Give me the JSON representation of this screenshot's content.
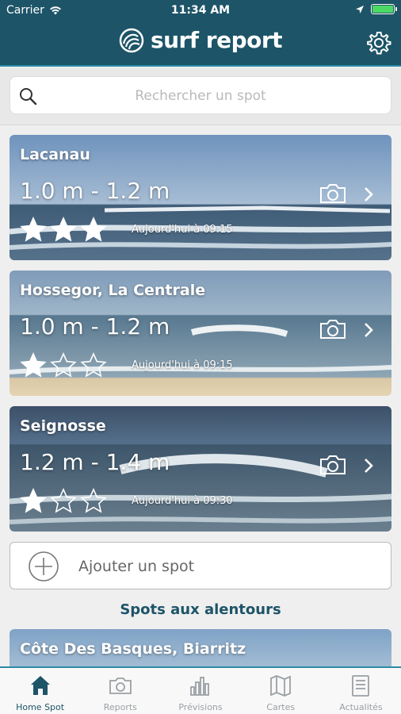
{
  "status_bar": {
    "carrier": "Carrier",
    "time": "11:34 AM"
  },
  "header": {
    "title": "surf report"
  },
  "search": {
    "placeholder": "Rechercher un spot"
  },
  "spots": [
    {
      "name": "Lacanau",
      "height": "1.0 m - 1.2 m",
      "rating": 3,
      "max_rating": 3,
      "time": "Aujourd'hui à 09:15"
    },
    {
      "name": "Hossegor, La Centrale",
      "height": "1.0 m - 1.2 m",
      "rating": 1,
      "max_rating": 3,
      "time": "Aujourd'hui à 09:15"
    },
    {
      "name": "Seignosse",
      "height": "1.2 m - 1.4 m",
      "rating": 1,
      "max_rating": 3,
      "time": "Aujourd'hui à 09:30"
    }
  ],
  "add_spot": {
    "label": "Ajouter un spot"
  },
  "nearby": {
    "title": "Spots aux alentours",
    "items": [
      {
        "name": "Côte Des Basques, Biarritz"
      }
    ]
  },
  "tabs": [
    {
      "label": "Home Spot",
      "icon": "home-icon",
      "active": true
    },
    {
      "label": "Reports",
      "icon": "camera-icon",
      "active": false
    },
    {
      "label": "Prévisions",
      "icon": "bar-chart-icon",
      "active": false
    },
    {
      "label": "Cartes",
      "icon": "map-icon",
      "active": false
    },
    {
      "label": "Actualités",
      "icon": "news-icon",
      "active": false
    }
  ],
  "colors": {
    "brand": "#1d5468",
    "accent": "#2b8aa5",
    "battery": "#4cd964"
  }
}
